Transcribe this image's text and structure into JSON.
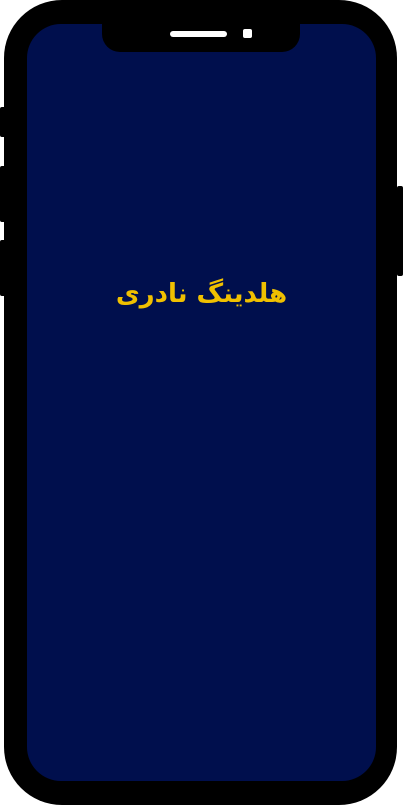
{
  "app": {
    "title": "هلدینگ نادری"
  },
  "colors": {
    "screen_background": "#000f4d",
    "title_color": "#f0c000",
    "frame": "#000000"
  },
  "icons": {
    "speaker": "speaker-grille",
    "camera": "front-camera"
  }
}
